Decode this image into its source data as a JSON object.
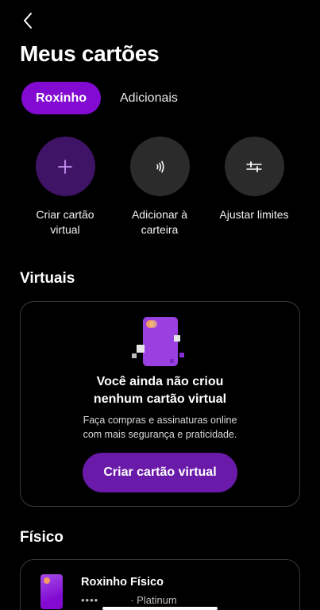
{
  "header": {
    "title": "Meus cartões",
    "back_icon": "chevron-left-icon"
  },
  "tabs": [
    {
      "label": "Roxinho",
      "active": true
    },
    {
      "label": "Adicionais",
      "active": false
    }
  ],
  "actions": [
    {
      "label": "Criar cartão\nvirtual",
      "icon": "plus-icon"
    },
    {
      "label": "Adicionar à\ncarteira",
      "icon": "contactless-icon"
    },
    {
      "label": "Ajustar limites",
      "icon": "sliders-icon"
    }
  ],
  "virtual": {
    "section_title": "Virtuais",
    "heading": "Você ainda não criou\nnenhum cartão virtual",
    "description": "Faça compras e assinaturas online\ncom mais segurança e praticidade.",
    "button_label": "Criar cartão virtual"
  },
  "physical": {
    "section_title": "Físico",
    "card_name": "Roxinho Físico",
    "masked_number": "••••",
    "tier": "· Platinum"
  },
  "colors": {
    "background": "#000000",
    "accent": "#820ad1",
    "accent_dark": "#3f1366",
    "button": "#6a1aa8",
    "surface": "#2b2b2b"
  }
}
